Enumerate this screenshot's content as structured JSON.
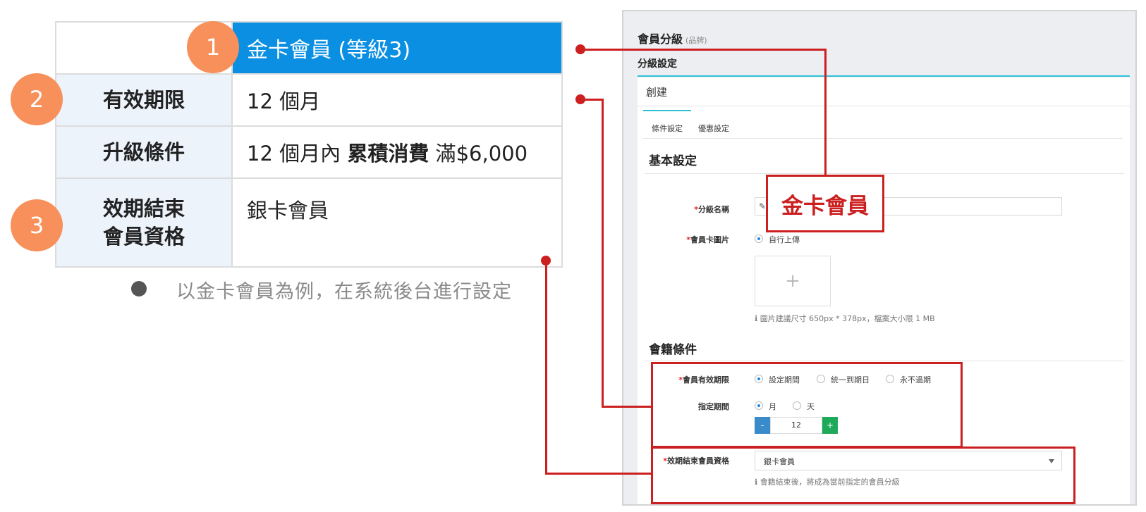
{
  "summary_table": {
    "header_value": "金卡會員 (等級3)",
    "rows": [
      {
        "label": "有效期限",
        "value": "12 個月"
      },
      {
        "label": "升級條件",
        "value_prefix": "12 個月內 ",
        "value_bold": "累積消費",
        "value_suffix": " 滿$6,000"
      },
      {
        "label_line1": "效期結束",
        "label_line2": "會員資格",
        "value": "銀卡會員"
      }
    ]
  },
  "badges": [
    "1",
    "2",
    "3"
  ],
  "note": "以金卡會員為例，在系統後台進行設定",
  "callout_text": "金卡會員",
  "admin": {
    "title": "會員分級",
    "title_tag": "(品牌)",
    "subtitle": "分級設定",
    "card_header": "創建",
    "tabs": [
      "條件設定",
      "優惠設定"
    ],
    "basic_section": "基本設定",
    "tier_name_label": "分級名稱",
    "card_image_label": "會員卡圖片",
    "card_image_option": "自行上傳",
    "upload_plus": "+",
    "image_hint": "圖片建議尺寸 650px * 378px，檔案大小限 1 MB",
    "membership_section": "會籍條件",
    "validity_label": "會員有效期限",
    "validity_options": [
      "設定期間",
      "統一到期日",
      "永不過期"
    ],
    "period_label": "指定期間",
    "period_options": [
      "月",
      "天"
    ],
    "stepper_minus": "-",
    "stepper_value": "12",
    "stepper_plus": "+",
    "expiry_label": "效期結束會員資格",
    "expiry_value": "銀卡會員",
    "expiry_hint": "會籍結束後，將成為當前指定的會員分級",
    "required_mark": "*"
  },
  "colors": {
    "header_blue": "#0a8fe3",
    "badge_orange": "#f7905a",
    "callout_red": "#cc1f1f",
    "tab_accent": "#2ec0d6",
    "minus_blue": "#3a8bc9",
    "plus_green": "#1faa5b"
  }
}
